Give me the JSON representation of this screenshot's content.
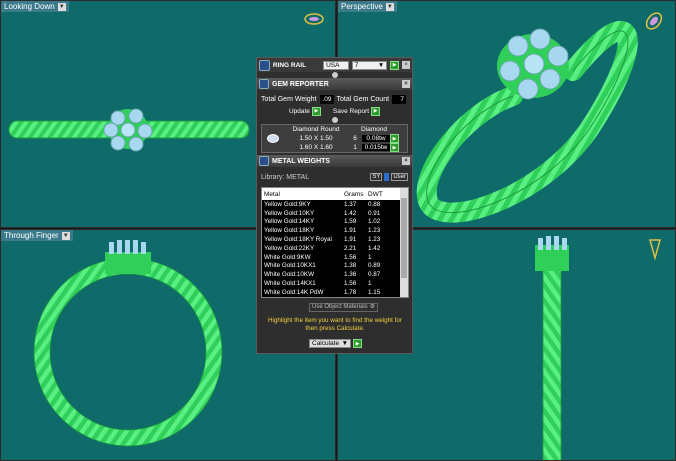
{
  "viewports": {
    "top_left_label": "Looking Down",
    "top_right_label": "Perspective",
    "bottom_left_label": "Through Finger",
    "bottom_right_label": ""
  },
  "ring_rail": {
    "title": "RING RAIL",
    "region": "USA",
    "size": "7"
  },
  "gem_reporter": {
    "title": "GEM REPORTER",
    "total_weight_label": "Total Gem Weight",
    "total_weight_value": ".09",
    "total_count_label": "Total Gem Count",
    "total_count_value": "7",
    "update_label": "Update",
    "save_label": "Save Report",
    "table": {
      "headers": [
        "Diamond Round",
        "Diamond"
      ],
      "rows": [
        {
          "size": "1.50 X 1.50",
          "count": "6",
          "weight": "0.08tw"
        },
        {
          "size": "1.60 X 1.60",
          "count": "1",
          "weight": "0.015tw"
        }
      ]
    }
  },
  "metal_weights": {
    "title": "METAL WEIGHTS",
    "library_label": "Library: METAL",
    "toggle_sys": "SY",
    "toggle_user": "User",
    "headers": {
      "metal": "Metal",
      "grams": "Grams",
      "dwt": "DWT"
    },
    "rows": [
      {
        "metal": "Yellow Gold:9KY",
        "grams": "1.37",
        "dwt": "0.88"
      },
      {
        "metal": "Yellow Gold:10KY",
        "grams": "1.42",
        "dwt": "0.91"
      },
      {
        "metal": "Yellow Gold:14KY",
        "grams": "1.59",
        "dwt": "1.02"
      },
      {
        "metal": "Yellow Gold:18KY",
        "grams": "1.91",
        "dwt": "1.23"
      },
      {
        "metal": "Yellow Gold:18KY Royal",
        "grams": "1.91",
        "dwt": "1.23"
      },
      {
        "metal": "Yellow Gold:22KY",
        "grams": "2.21",
        "dwt": "1.42"
      },
      {
        "metal": "White Gold:9KW",
        "grams": "1.56",
        "dwt": "1"
      },
      {
        "metal": "White Gold:10KX1",
        "grams": "1.38",
        "dwt": "0.89"
      },
      {
        "metal": "White Gold:10KW",
        "grams": "1.36",
        "dwt": "0.87"
      },
      {
        "metal": "White Gold:14KX1",
        "grams": "1.56",
        "dwt": "1"
      },
      {
        "metal": "White Gold:14K PdW",
        "grams": "1.78",
        "dwt": "1.15"
      }
    ],
    "use_object_materials": "Use Object Materials",
    "hint": "Highlight the item you want to find the weight for then press Calculate.",
    "calculate": "Calculate"
  },
  "colors": {
    "viewport_bg": "#0f6a6a",
    "ring_green": "#3ee06a",
    "gem_blue": "#a8d8f0",
    "hint_yellow": "#f0d040"
  }
}
